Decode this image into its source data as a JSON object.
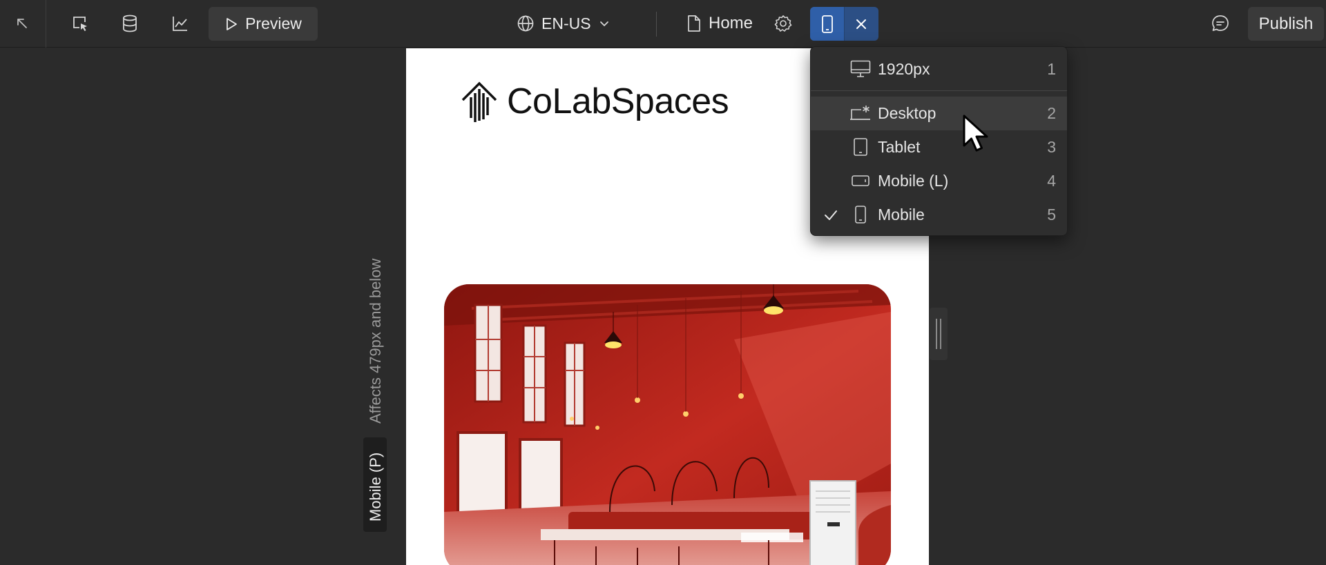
{
  "toolbar": {
    "preview_label": "Preview",
    "locale_label": "EN-US",
    "page_label": "Home",
    "publish_label": "Publish"
  },
  "canvas": {
    "logo_text": "CoLabSpaces",
    "affects_text": "Affects 479px and below",
    "breakpoint_tag": "Mobile (P)"
  },
  "breakpoint_menu": {
    "items": [
      {
        "label": "1920px",
        "shortcut": "1",
        "icon": "desktop-monitor-icon",
        "checked": false
      },
      {
        "label": "Desktop",
        "shortcut": "2",
        "icon": "desktop-star-icon",
        "checked": false
      },
      {
        "label": "Tablet",
        "shortcut": "3",
        "icon": "tablet-icon",
        "checked": false
      },
      {
        "label": "Mobile (L)",
        "shortcut": "4",
        "icon": "mobile-landscape-icon",
        "checked": false
      },
      {
        "label": "Mobile",
        "shortcut": "5",
        "icon": "mobile-icon",
        "checked": true
      }
    ]
  },
  "colors": {
    "toolbar_bg": "#2b2b2b",
    "accent_blue": "#2f5fa8",
    "canvas_bg": "#ffffff",
    "hero_red": "#b5221d"
  }
}
